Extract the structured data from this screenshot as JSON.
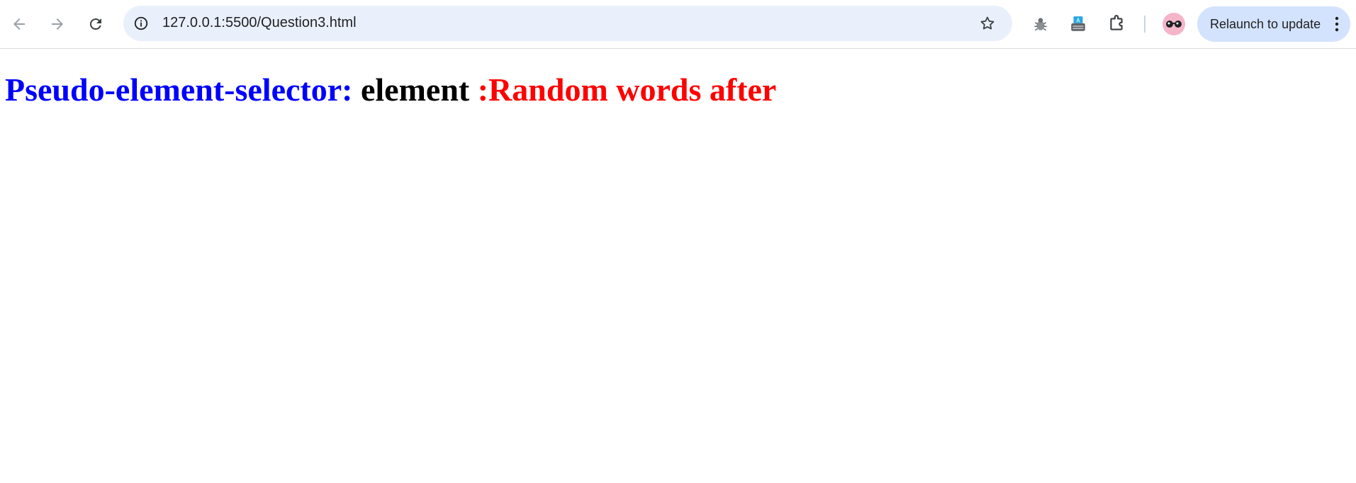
{
  "browser": {
    "url": "127.0.0.1:5500/Question3.html",
    "relaunch_label": "Relaunch to update",
    "accent_color": "#d3e3fd",
    "omnibox_color": "#eaf0fb",
    "extensions": [
      "bug-extension-icon",
      "typewriter-extension-icon",
      "puzzle-extensions-icon"
    ]
  },
  "page": {
    "selector_label": "Pseudo-element-selector:",
    "element_text": "element",
    "after_text": ":Random words after",
    "colors": {
      "selector": "#0000ff",
      "element": "#000000",
      "after": "#ff0000"
    }
  }
}
